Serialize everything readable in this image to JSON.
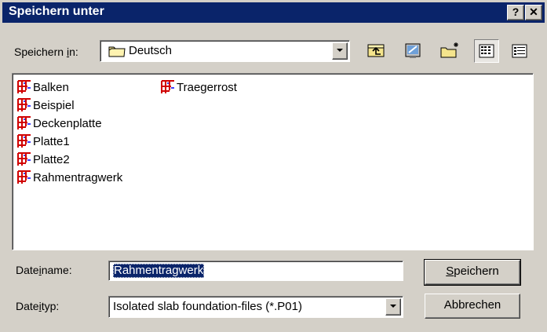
{
  "window": {
    "title": "Speichern unter",
    "help_button": "?",
    "close_button": "✕"
  },
  "save_in": {
    "label_pre": "Speichern ",
    "label_hot": "i",
    "label_post": "n:",
    "value": "Deutsch"
  },
  "toolbar": {
    "items": [
      "up-one-level-icon",
      "desktop-icon",
      "new-folder-icon",
      "list-view-icon",
      "details-view-icon"
    ]
  },
  "files": [
    {
      "name": "Balken"
    },
    {
      "name": "Beispiel"
    },
    {
      "name": "Deckenplatte"
    },
    {
      "name": "Platte1"
    },
    {
      "name": "Platte2"
    },
    {
      "name": "Rahmentragwerk"
    },
    {
      "name": "Traegerrost"
    }
  ],
  "filename": {
    "label_pre": "Date",
    "label_hot": "i",
    "label_post": "name:",
    "value": "Rahmentragwerk"
  },
  "filetype": {
    "label_pre": "Date",
    "label_hot": "i",
    "label_post": "typ:",
    "value": "Isolated slab foundation-files (*.P01)"
  },
  "buttons": {
    "save_hot": "S",
    "save_rest": "peichern",
    "cancel": "Abbrechen"
  },
  "colors": {
    "titlebar": "#0a246a",
    "face": "#d4d0c8",
    "selection": "#0a246a",
    "file_icon": "#d00000"
  }
}
